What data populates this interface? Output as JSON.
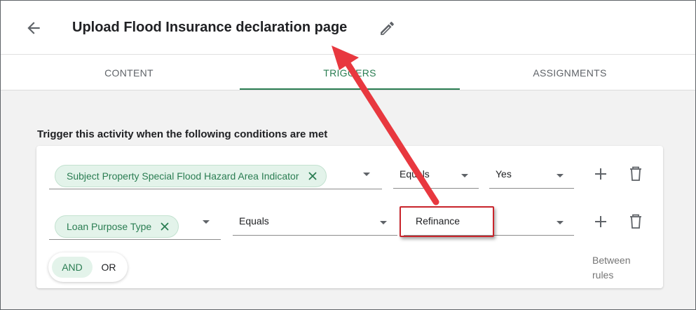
{
  "header": {
    "title": "Upload Flood Insurance declaration page",
    "back_icon": "arrow-left-icon",
    "edit_icon": "pencil-icon"
  },
  "tabs": [
    {
      "label": "CONTENT",
      "active": false
    },
    {
      "label": "TRIGGERS",
      "active": true
    },
    {
      "label": "ASSIGNMENTS",
      "active": false
    }
  ],
  "triggers": {
    "title": "Trigger this activity when the following conditions are met",
    "conditions": [
      {
        "field": "Subject Property Special Flood Hazard Area Indicator",
        "operator": "Equals",
        "value": "Yes"
      },
      {
        "field": "Loan Purpose Type",
        "operator": "Equals",
        "value": "Refinance"
      }
    ],
    "logic": {
      "and_label": "AND",
      "or_label": "OR",
      "selected": "AND"
    },
    "between_rules_label": "Between rules",
    "add_icon": "plus-icon",
    "delete_icon": "trash-icon"
  },
  "colors": {
    "accent": "#2a7d52",
    "chip_bg": "#e3f3ea",
    "annotation": "#e8383f"
  }
}
